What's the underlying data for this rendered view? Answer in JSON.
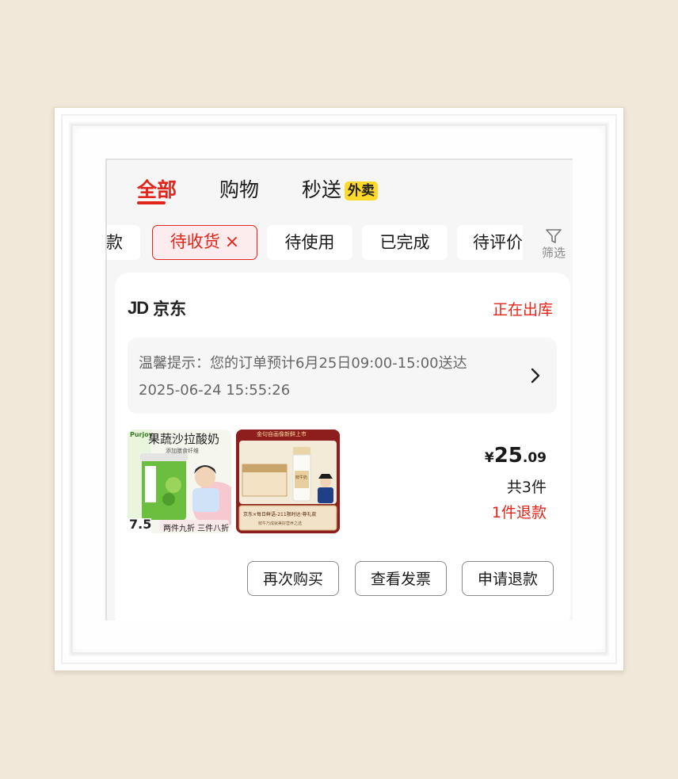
{
  "tabs": [
    {
      "label": "全部",
      "active": true
    },
    {
      "label": "购物",
      "active": false
    },
    {
      "label": "秒送",
      "active": false,
      "badge": "外卖"
    }
  ],
  "chips": [
    {
      "label": "款",
      "active": false
    },
    {
      "label": "待收货",
      "active": true,
      "close": "×"
    },
    {
      "label": "待使用",
      "active": false
    },
    {
      "label": "已完成",
      "active": false
    },
    {
      "label": "待评价",
      "active": false
    }
  ],
  "filter": {
    "label": "筛选"
  },
  "order": {
    "shop_logo": "JD",
    "shop_name": "京东",
    "status": "正在出库",
    "tip": "温馨提示：您的订单预计6月25日09:00-15:00送达",
    "tip_time": "2025-06-24 15:55:26",
    "products": [
      {
        "brand": "Purjoy",
        "title": "果蔬沙拉酸奶",
        "sub": "添加膳食纤维",
        "price_tag": "7.5",
        "promo": "两件九折 三件八折"
      },
      {
        "banner": "金句自画像新鲜上市",
        "label": "鲜牛奶",
        "footer": "京东×每日鲜语-211限时达·尊礼款",
        "footer2": "鲜牛乃成就美好营养之选"
      }
    ],
    "price_currency": "¥",
    "price_int": "25",
    "price_dec": ".09",
    "item_count": "共3件",
    "refund": "1件退款",
    "actions": [
      "再次购买",
      "查看发票",
      "申请退款"
    ]
  },
  "colors": {
    "accent": "#e1251b",
    "badge": "#ffd92a",
    "background": "#f1e8d9"
  }
}
